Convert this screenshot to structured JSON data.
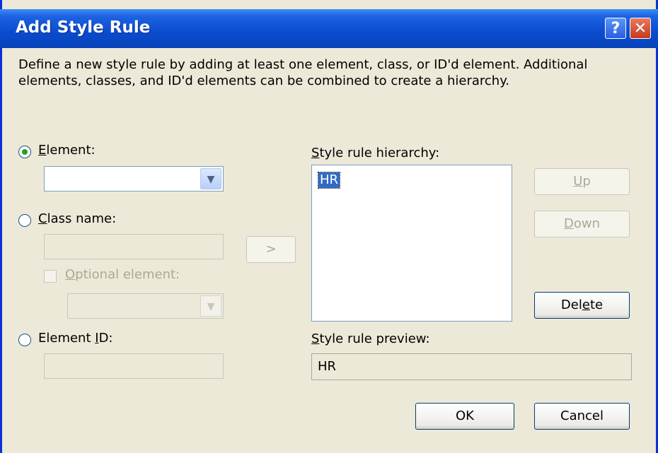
{
  "dialog": {
    "title": "Add Style Rule",
    "help_glyph": "?",
    "close_glyph": "✕",
    "description_line1": "Define a new style rule by adding at least one element, class, or ID'd element.  Additional",
    "description_line2": "elements, classes, and ID'd elements can be combined to create a hierarchy."
  },
  "left": {
    "element_label_first": "E",
    "element_label_rest": "lement:",
    "element_value": "",
    "class_label_first": "C",
    "class_label_rest": "lass name:",
    "class_value": "",
    "optional_label_first": "O",
    "optional_label_rest": "ptional element:",
    "optional_value": "",
    "id_label_pre": "Element ",
    "id_label_key": "I",
    "id_label_rest": "D:",
    "id_value": ""
  },
  "middle": {
    "add_button": ">"
  },
  "right": {
    "hierarchy_label_first": "S",
    "hierarchy_label_rest": "tyle rule hierarchy:",
    "hierarchy_items": [
      "HR"
    ],
    "up_key": "U",
    "up_rest": "p",
    "down_key": "D",
    "down_rest": "own",
    "delete_pre": "Del",
    "delete_key": "e",
    "delete_rest": "te",
    "preview_label_first": "S",
    "preview_label_rest": "tyle rule preview:",
    "preview_value": "HR"
  },
  "footer": {
    "ok": "OK",
    "cancel": "Cancel"
  },
  "state": {
    "selected_radio": "Element"
  }
}
